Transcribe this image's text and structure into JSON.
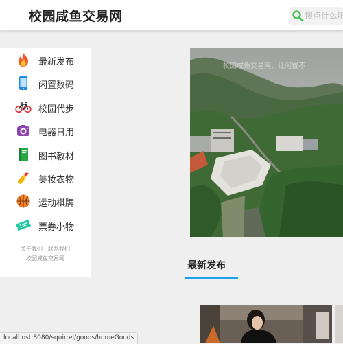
{
  "header": {
    "brand": "校园咸鱼交易网",
    "search_placeholder": "搜点什么吧"
  },
  "sidebar": {
    "items": [
      {
        "label": "最新发布",
        "icon": "fire-icon"
      },
      {
        "label": "闲置数码",
        "icon": "phone-icon"
      },
      {
        "label": "校园代步",
        "icon": "bicycle-icon"
      },
      {
        "label": "电器日用",
        "icon": "camera-icon"
      },
      {
        "label": "图书教材",
        "icon": "book-icon"
      },
      {
        "label": "美妆衣物",
        "icon": "lipstick-icon"
      },
      {
        "label": "运动棋牌",
        "icon": "basketball-icon"
      },
      {
        "label": "票券小物",
        "icon": "ticket-icon"
      }
    ],
    "footer": {
      "about": "关于我们",
      "sep": " - ",
      "contact": "联系我们",
      "site": "校园咸鱼交易网"
    }
  },
  "banner": {
    "caption": "校园咸鱼交易网，让闲置不"
  },
  "section": {
    "title": "最新发布"
  },
  "status_bar": {
    "url": "localhost:8080/squirrel/goods/homeGoods"
  },
  "colors": {
    "accent": "#1aa3e8",
    "search_icon": "#4cc35a"
  }
}
